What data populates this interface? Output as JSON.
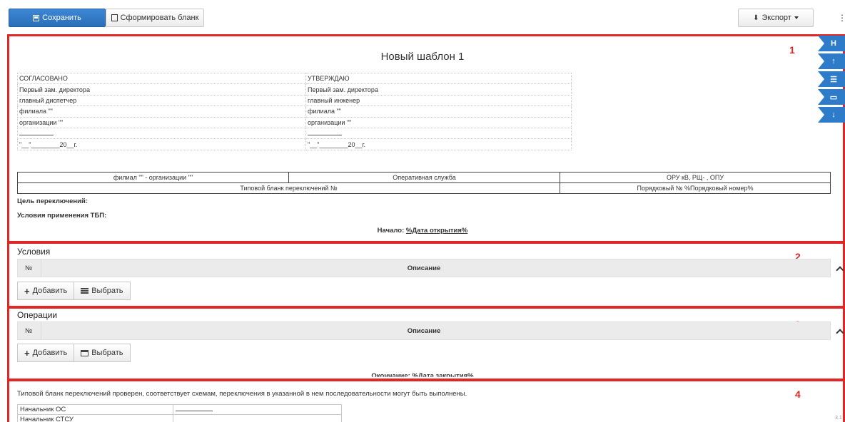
{
  "toolbar": {
    "save_label": "Сохранить",
    "form_label": "Сформировать бланк",
    "export_label": "Экспорт",
    "menu_icon": "⋮"
  },
  "annotations": [
    "1",
    "2",
    "3",
    "4"
  ],
  "side_nav": [
    "H",
    "↑",
    "☰",
    "▭",
    "↓"
  ],
  "document": {
    "title": "Новый шаблон 1",
    "approval": [
      [
        "СОГЛАСОВАНО",
        "УТВЕРЖДАЮ"
      ],
      [
        "Первый зам. директора",
        "Первый зам. директора"
      ],
      [
        "главный диспетчер",
        "главный инженер"
      ],
      [
        "филиала \"\"",
        "филиала \"\""
      ],
      [
        "организации \"\"",
        "организации \"\""
      ],
      [
        "",
        ""
      ],
      [
        "\"__\"________20__г.",
        "\"__\"________20__г."
      ]
    ],
    "header_row1": [
      "филиал \"\" - организации \"\"",
      "Оперативная служба",
      "ОРУ   кВ, РЩ-   , ОПУ"
    ],
    "header_row2": [
      "Типовой бланк переключений №",
      "Порядковый № %Порядковый номер%"
    ],
    "goal_label": "Цель переключений:",
    "conditions_label": "Условия применения ТБП:",
    "start_label": "Начало: ",
    "start_value": "%Дата открытия%"
  },
  "conditions": {
    "title": "Условия",
    "col_no": "№",
    "col_desc": "Описание",
    "add_label": "Добавить",
    "select_label": "Выбрать"
  },
  "operations": {
    "title": "Операции",
    "col_no": "№",
    "col_desc": "Описание",
    "add_label": "Добавить",
    "select_label": "Выбрать",
    "end_text": "Окончание: %Дата закрытия%"
  },
  "footer": {
    "verify_text": "Типовой бланк переключений проверен, соответствует схемам, переключения в указанной в нем последовательности могут быть выполнены.",
    "signers": [
      "Начальник ОС",
      "Начальник СТСУ"
    ],
    "version": "3.1"
  }
}
